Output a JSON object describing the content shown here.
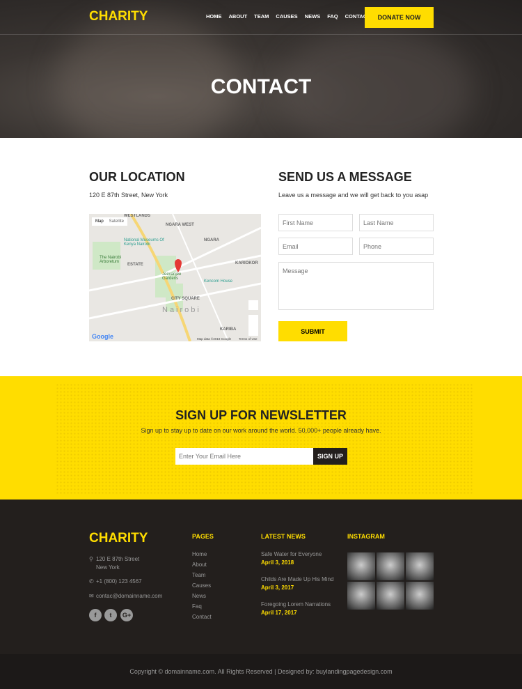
{
  "nav": {
    "logo": "CHARITY",
    "items": [
      "HOME",
      "ABOUT",
      "TEAM",
      "CAUSES",
      "NEWS",
      "FAQ",
      "CONTACT"
    ],
    "donate": "DONATE NOW"
  },
  "hero": {
    "title": "CONTACT"
  },
  "location": {
    "title": "OUR LOCATION",
    "address": "120 E 87th Street, New York",
    "map": {
      "tab_map": "Map",
      "tab_satellite": "Satellite",
      "labels": [
        "WESTLANDS",
        "NGARA WEST",
        "NGARA",
        "National Museums Of Kenya Nairobi",
        "The Nairobi Arboretum",
        "ESTATE",
        "Jeevanjee Gardens",
        "Kencom House",
        "CITY SQUARE",
        "Nairobi",
        "KARIBA",
        "KARIOKOR"
      ],
      "attribution": "Map data ©2018 Google",
      "terms": "Terms of Use",
      "google": "Google"
    }
  },
  "message": {
    "title": "SEND US A MESSAGE",
    "subtitle": "Leave us a message and we will get back to you asap",
    "first_name": "First Name",
    "last_name": "Last Name",
    "email": "Email",
    "phone": "Phone",
    "message": "Message",
    "submit": "SUBMIT"
  },
  "newsletter": {
    "title": "SIGN UP FOR NEWSLETTER",
    "subtitle": "Sign up to stay up to date on our work around the world. 50,000+ people already have.",
    "placeholder": "Enter Your Email Here",
    "button": "SIGN UP"
  },
  "footer": {
    "logo": "CHARITY",
    "address1": "120 E 87th Street",
    "address2": "New York",
    "phone": "+1 (800) 123 4567",
    "email": "contac@domainname.com",
    "pages_title": "PAGES",
    "pages": [
      "Home",
      "About",
      "Team",
      "Causes",
      "News",
      "Faq",
      "Contact"
    ],
    "news_title": "LATEST NEWS",
    "news": [
      {
        "title": "Safe Water for Everyone",
        "date": "April 3, 2018"
      },
      {
        "title": "Childs Are Made Up His Mind",
        "date": "April 3, 2017"
      },
      {
        "title": "Foregoing Lorem Narrations",
        "date": "April 17, 2017"
      }
    ],
    "instagram_title": "INSTAGRAM",
    "social": [
      "f",
      "t",
      "G+"
    ]
  },
  "copyright": "Copyright © domainname.com. All Rights Reserved  |  Designed by: buylandingpagedesign.com",
  "colors": {
    "accent": "#ffdd00",
    "footer": "#231f1d"
  }
}
